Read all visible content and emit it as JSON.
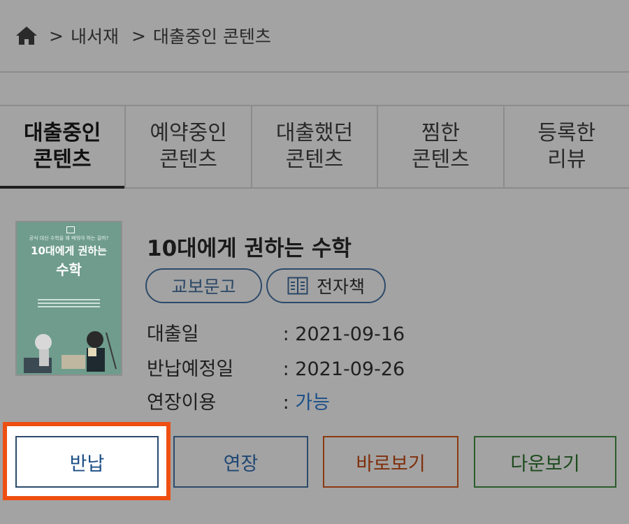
{
  "breadcrumb": {
    "separator": ">",
    "items": [
      "내서재",
      "대출중인 콘텐츠"
    ]
  },
  "tabs": [
    {
      "line1": "대출중인",
      "line2": "콘텐츠",
      "active": true
    },
    {
      "line1": "예약중인",
      "line2": "콘텐츠",
      "active": false
    },
    {
      "line1": "대출했던",
      "line2": "콘텐츠",
      "active": false
    },
    {
      "line1": "찜한",
      "line2": "콘텐츠",
      "active": false
    },
    {
      "line1": "등록한",
      "line2": "리뷰",
      "active": false
    }
  ],
  "book": {
    "title": "10대에게 권하는 수학",
    "cover": {
      "subtitle": "공식 대신 수학을 왜 배워야 하는 걸까?",
      "title_line1": "10대에게 권하는",
      "title_line2": "수학"
    },
    "publisher": "교보문고",
    "type": "전자책",
    "info": [
      {
        "label": "대출일",
        "colon": ":",
        "value": "2021-09-16"
      },
      {
        "label": "반납예정일",
        "colon": ":",
        "value": "2021-09-26"
      },
      {
        "label": "연장이용",
        "colon": ":",
        "value": "가능"
      }
    ]
  },
  "buttons": {
    "return": "반납",
    "extend": "연장",
    "read": "바로보기",
    "download": "다운보기"
  },
  "colors": {
    "overlay_gray": "#a3a3a3",
    "highlight": "#ee4f11",
    "blue_text": "#1b4f8a",
    "read_button": "#8a3a12",
    "download_button": "#2a5c2a"
  }
}
